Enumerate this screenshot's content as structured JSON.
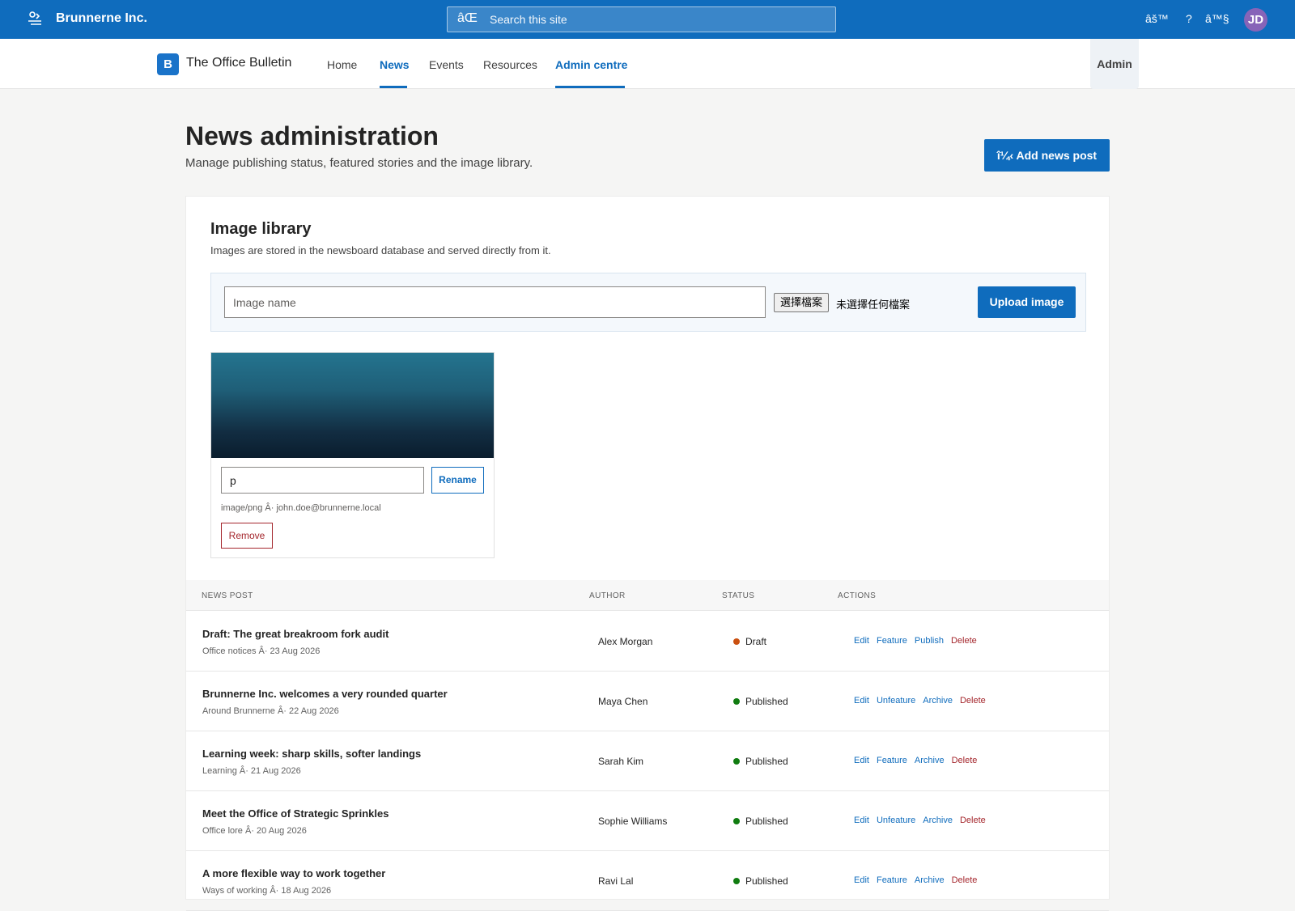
{
  "suite": {
    "brand": "Brunnerne Inc.",
    "app_launcher_icon": "app-launcher-icon",
    "search_placeholder": "Search this site",
    "search_icon_glyph": "âŒ",
    "icon_settings_glyph": "âš™",
    "icon_help_glyph": "?",
    "icon_people_glyph": "â™§",
    "avatar_initials": "JD",
    "colors": {
      "bar": "#0f6cbd",
      "avatar": "#8764b8"
    }
  },
  "site": {
    "logo_letter": "B",
    "title": "The Office Bulletin",
    "nav": [
      {
        "label": "Home"
      },
      {
        "label": "News"
      },
      {
        "label": "Events"
      },
      {
        "label": "Resources"
      },
      {
        "label": "Admin centre"
      }
    ],
    "admin_label": "Admin"
  },
  "page": {
    "title": "News administration",
    "subtitle": "Manage publishing status, featured stories and the image library.",
    "add_button": "î¼‹ Add news post"
  },
  "library": {
    "title": "Image library",
    "description": "Images are stored in the newsboard database and served directly from it.",
    "name_placeholder": "Image name",
    "file_button": "選擇檔案",
    "file_status": "未選擇任何檔案",
    "upload_button": "Upload image",
    "image": {
      "name_value": "p",
      "rename_button": "Rename",
      "meta": "image/png Â· john.doe@brunnerne.local",
      "remove_button": "Remove"
    }
  },
  "table": {
    "headers": [
      "News post",
      "Author",
      "Status",
      "Actions"
    ],
    "rows": [
      {
        "title": "Draft: The great breakroom fork audit",
        "meta": "Office notices Â· 23 Aug 2026",
        "author": "Alex Morgan",
        "status": "Draft",
        "status_color": "#ca5010",
        "actions": [
          "Edit",
          "Feature",
          "Publish",
          "Delete"
        ]
      },
      {
        "title": "Brunnerne Inc. welcomes a very rounded quarter",
        "meta": "Around Brunnerne Â· 22 Aug 2026",
        "author": "Maya Chen",
        "status": "Published",
        "status_color": "#107c10",
        "actions": [
          "Edit",
          "Unfeature",
          "Archive",
          "Delete"
        ]
      },
      {
        "title": "Learning week: sharp skills, softer landings",
        "meta": "Learning Â· 21 Aug 2026",
        "author": "Sarah Kim",
        "status": "Published",
        "status_color": "#107c10",
        "actions": [
          "Edit",
          "Feature",
          "Archive",
          "Delete"
        ]
      },
      {
        "title": "Meet the Office of Strategic Sprinkles",
        "meta": "Office lore Â· 20 Aug 2026",
        "author": "Sophie Williams",
        "status": "Published",
        "status_color": "#107c10",
        "actions": [
          "Edit",
          "Unfeature",
          "Archive",
          "Delete"
        ]
      },
      {
        "title": "A more flexible way to work together",
        "meta": "Ways of working Â· 18 Aug 2026",
        "author": "Ravi Lal",
        "status": "Published",
        "status_color": "#107c10",
        "actions": [
          "Edit",
          "Feature",
          "Archive",
          "Delete"
        ]
      }
    ]
  }
}
